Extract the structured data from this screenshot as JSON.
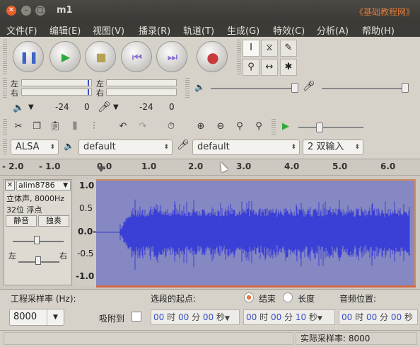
{
  "window": {
    "title": "m1",
    "watermark": "《基础教程网》"
  },
  "menu": [
    "文件(F)",
    "编辑(E)",
    "视图(V)",
    "播录(R)",
    "轨道(T)",
    "生成(G)",
    "特效(C)",
    "分析(A)",
    "帮助(H)"
  ],
  "meters": {
    "left_label": "左",
    "right_label": "右",
    "play_db": "-24",
    "play_zero": "0",
    "rec_db": "-24",
    "rec_zero": "0"
  },
  "device": {
    "host": "ALSA",
    "output": "default",
    "input": "default",
    "channels": "2 双输入"
  },
  "ruler": {
    "ticks": [
      "- 2.0",
      "- 1.0",
      "0.0",
      "1.0",
      "2.0",
      "3.0",
      "4.0",
      "5.0",
      "6.0"
    ]
  },
  "track": {
    "name": "alim8786",
    "info1": "立体声, 8000Hz",
    "info2": "32位 浮点",
    "mute": "静音",
    "solo": "独奏",
    "pan_left": "左",
    "pan_right": "右",
    "scale": [
      "1.0",
      "0.5",
      "0.0-",
      "-0.5",
      "-1.0"
    ]
  },
  "bottom": {
    "rate_label": "工程采样率 (Hz):",
    "rate_value": "8000",
    "snap_label": "吸附到",
    "sel_start_label": "选段的起点:",
    "end_label": "结束",
    "length_label": "长度",
    "audio_pos_label": "音频位置:",
    "t1": {
      "h": "00",
      "hu": "时",
      "m": "00",
      "mu": "分",
      "s": "00",
      "su": "秒"
    },
    "t2": {
      "h": "00",
      "hu": "时",
      "m": "00",
      "mu": "分",
      "s": "10",
      "su": "秒"
    },
    "t3": {
      "h": "00",
      "hu": "时",
      "m": "00",
      "mu": "分",
      "s": "00",
      "su": "秒"
    }
  },
  "status": {
    "actual_rate": "实际采样率:  8000"
  }
}
